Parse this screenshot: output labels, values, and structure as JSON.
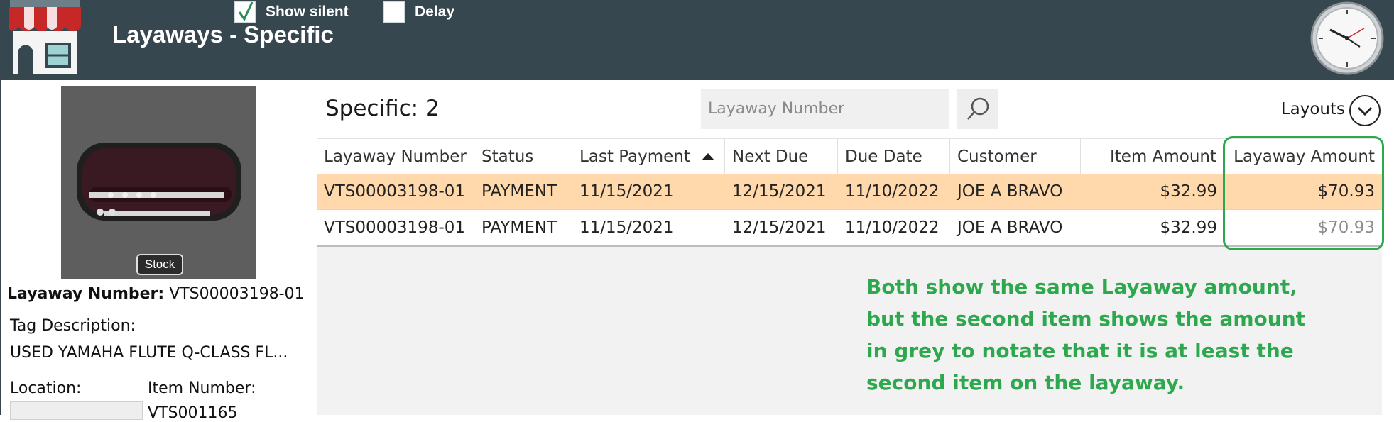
{
  "header": {
    "title": "Layaways - Specific",
    "show_silent_label": "Show silent",
    "show_silent_checked": true,
    "delay_label": "Delay",
    "delay_checked": false,
    "logo_icon": "store-icon",
    "clock_icon": "clock-icon"
  },
  "left_panel": {
    "stock_badge": "Stock",
    "layaway_number_label": "Layaway Number:",
    "layaway_number_value": "VTS00003198-01",
    "tag_description_label": "Tag Description:",
    "tag_description_value": "USED YAMAHA FLUTE Q-CLASS FL...",
    "location_label": "Location:",
    "item_number_label": "Item Number:",
    "item_number_value": "VTS001165"
  },
  "main": {
    "specific_label": "Specific: 2",
    "search_placeholder": "Layaway Number",
    "layouts_label": "Layouts",
    "columns": [
      "Layaway Number",
      "Status",
      "Last Payment",
      "Next Due",
      "Due Date",
      "Customer",
      "Item Amount",
      "Layaway Amount"
    ],
    "sorted_column": "Last Payment",
    "rows": [
      [
        "VTS00003198-01",
        "PAYMENT",
        "11/15/2021",
        "12/15/2021",
        "11/10/2022",
        "JOE A BRAVO",
        "$32.99",
        "$70.93"
      ],
      [
        "VTS00003198-01",
        "PAYMENT",
        "11/15/2021",
        "12/15/2021",
        "11/10/2022",
        "JOE A BRAVO",
        "$32.99",
        "$70.93"
      ]
    ]
  },
  "annotation": {
    "line1": "Both show the same Layaway amount,",
    "line2": "but the second item shows the amount",
    "line3": "in grey to notate that it is at least the",
    "line4": "second item on the layaway."
  },
  "colors": {
    "header_bg": "#37474f",
    "selected_row": "#ffd9ab",
    "annotation_green": "#2ea84e",
    "grey_amount": "#8c8c8c"
  }
}
